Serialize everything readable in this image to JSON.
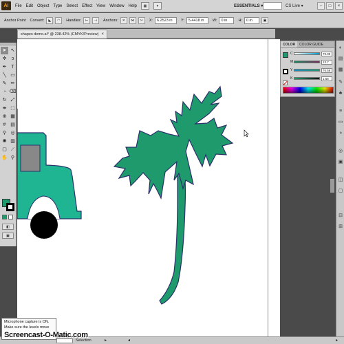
{
  "menu": {
    "app_logo": "Ai",
    "items": [
      "File",
      "Edit",
      "Object",
      "Type",
      "Select",
      "Effect",
      "View",
      "Window",
      "Help"
    ],
    "workspace": "ESSENTIALS ▾",
    "cslive": "CS Live ▾"
  },
  "control": {
    "anchor_point": "Anchor Point",
    "convert": "Convert:",
    "handles": "Handles:",
    "anchors": "Anchors:",
    "x_label": "X:",
    "x_value": "6.2523 in",
    "y_label": "Y:",
    "y_value": "5.4418 in",
    "w_label": "W:",
    "w_value": "0 in",
    "h_label": "H:",
    "h_value": "0 in"
  },
  "document": {
    "tab_title": "shapes demo.ai* @ 238.42% (CMYK/Preview)",
    "tab_close": "×"
  },
  "color_panel": {
    "tabs": [
      "COLOR",
      "COLOR GUIDE"
    ],
    "channels": [
      {
        "label": "C",
        "value": "79.09",
        "color": "#00a0d0"
      },
      {
        "label": "M",
        "value": "13.7",
        "color": "#d0308a"
      },
      {
        "label": "Y",
        "value": "76.56",
        "color": "#e6d21a"
      },
      {
        "label": "K",
        "value": "1.56",
        "color": "#222222"
      }
    ]
  },
  "status": {
    "zoom": "",
    "tool": "Selection"
  },
  "notice": {
    "line1": "Microphone capture is ON.",
    "line2": "Make sure the levels move",
    "watermark": "Screencast-O-Matic.com"
  },
  "colors": {
    "fill": "#1e9a6c",
    "truck": "#1fb593",
    "stroke": "#2b2f6a"
  }
}
